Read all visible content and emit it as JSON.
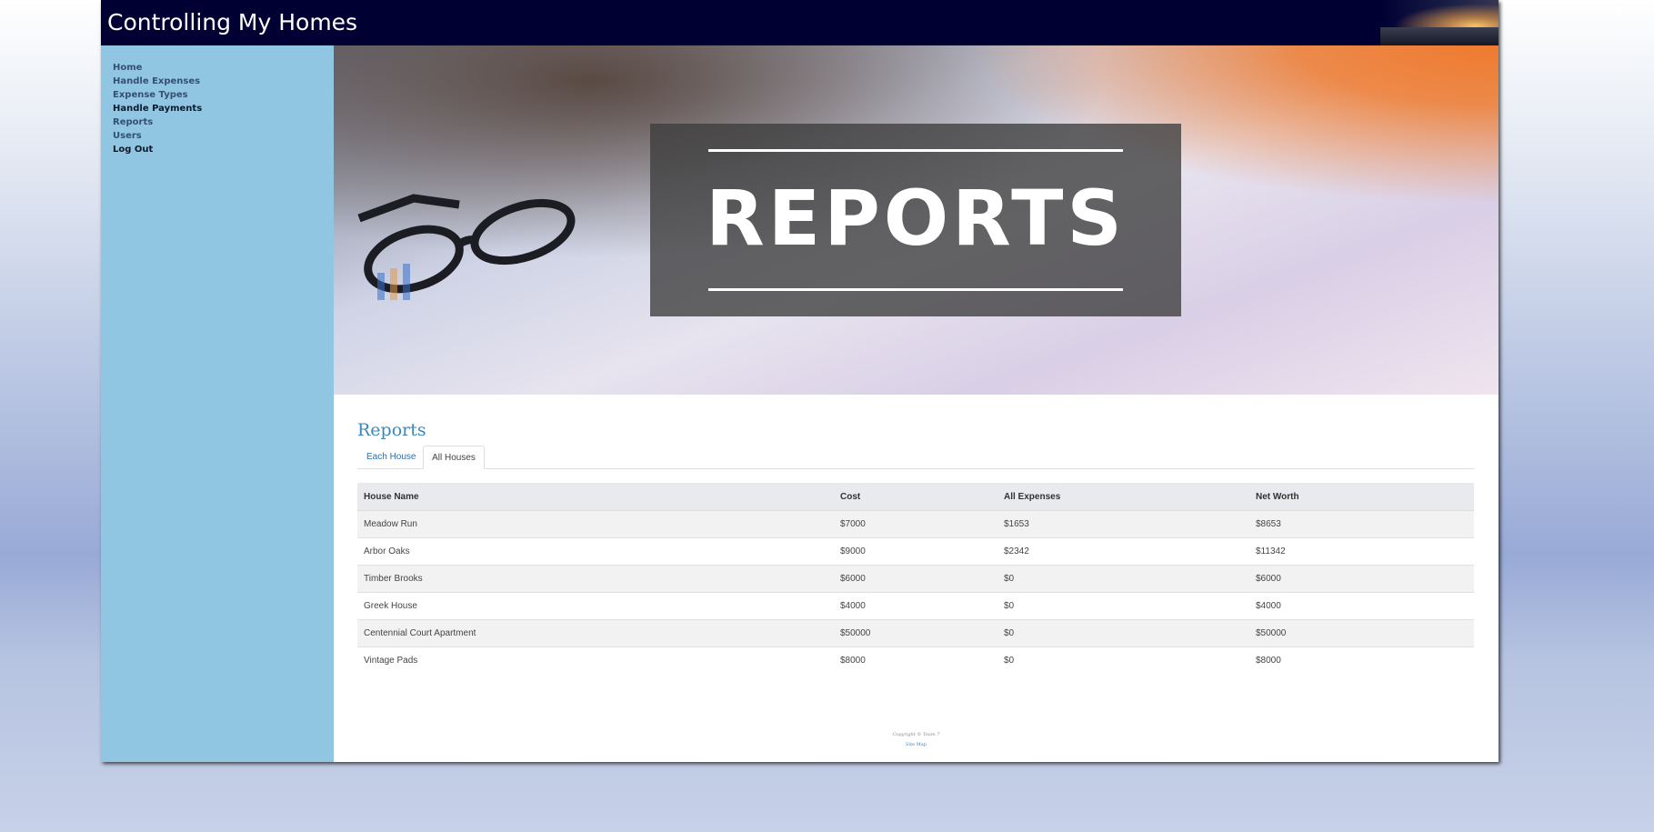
{
  "header": {
    "title": "Controlling My Homes"
  },
  "sidebar": {
    "items": [
      {
        "label": "Home"
      },
      {
        "label": "Handle Expenses"
      },
      {
        "label": "Expense Types"
      },
      {
        "label": "Handle Payments"
      },
      {
        "label": "Reports"
      },
      {
        "label": "Users"
      },
      {
        "label": "Log Out"
      }
    ]
  },
  "banner": {
    "text": "REPORTS"
  },
  "main": {
    "heading": "Reports",
    "tabs": [
      {
        "label": "Each House"
      },
      {
        "label": "All Houses",
        "active": true
      }
    ],
    "table": {
      "columns": [
        "House Name",
        "Cost",
        "All Expenses",
        "Net Worth"
      ],
      "rows": [
        [
          "Meadow Run",
          "$7000",
          "$1653",
          "$8653"
        ],
        [
          "Arbor Oaks",
          "$9000",
          "$2342",
          "$11342"
        ],
        [
          "Timber Brooks",
          "$6000",
          "$0",
          "$6000"
        ],
        [
          "Greek House",
          "$4000",
          "$0",
          "$4000"
        ],
        [
          "Centennial Court Apartment",
          "$50000",
          "$0",
          "$50000"
        ],
        [
          "Vintage Pads",
          "$8000",
          "$0",
          "$8000"
        ]
      ]
    }
  },
  "footer": {
    "copyright": "Copyright © Team 7",
    "sitemap": "Site Map"
  },
  "colors": {
    "header_bg": "#000033",
    "sidebar_bg": "#91c6e2",
    "heading": "#3d87b8",
    "link": "#2f6fa9"
  }
}
